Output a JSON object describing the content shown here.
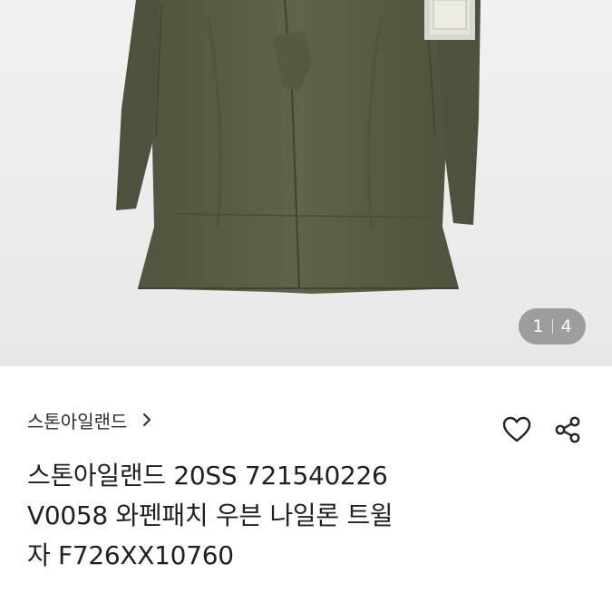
{
  "gallery": {
    "current_page": "1",
    "total_pages": "4",
    "background_color": "#eeeeee",
    "product_color": "#5b6147"
  },
  "product": {
    "brand": "스톤아일랜드",
    "title_lines": [
      "스톤아일랜드 20SS 721540226",
      "V0058 와펜패치 우븐 나일론 트윌",
      "자 F726XX10760"
    ]
  },
  "icons": {
    "brand_link": "chevron-right-icon",
    "like": "heart-icon",
    "share": "share-icon"
  }
}
